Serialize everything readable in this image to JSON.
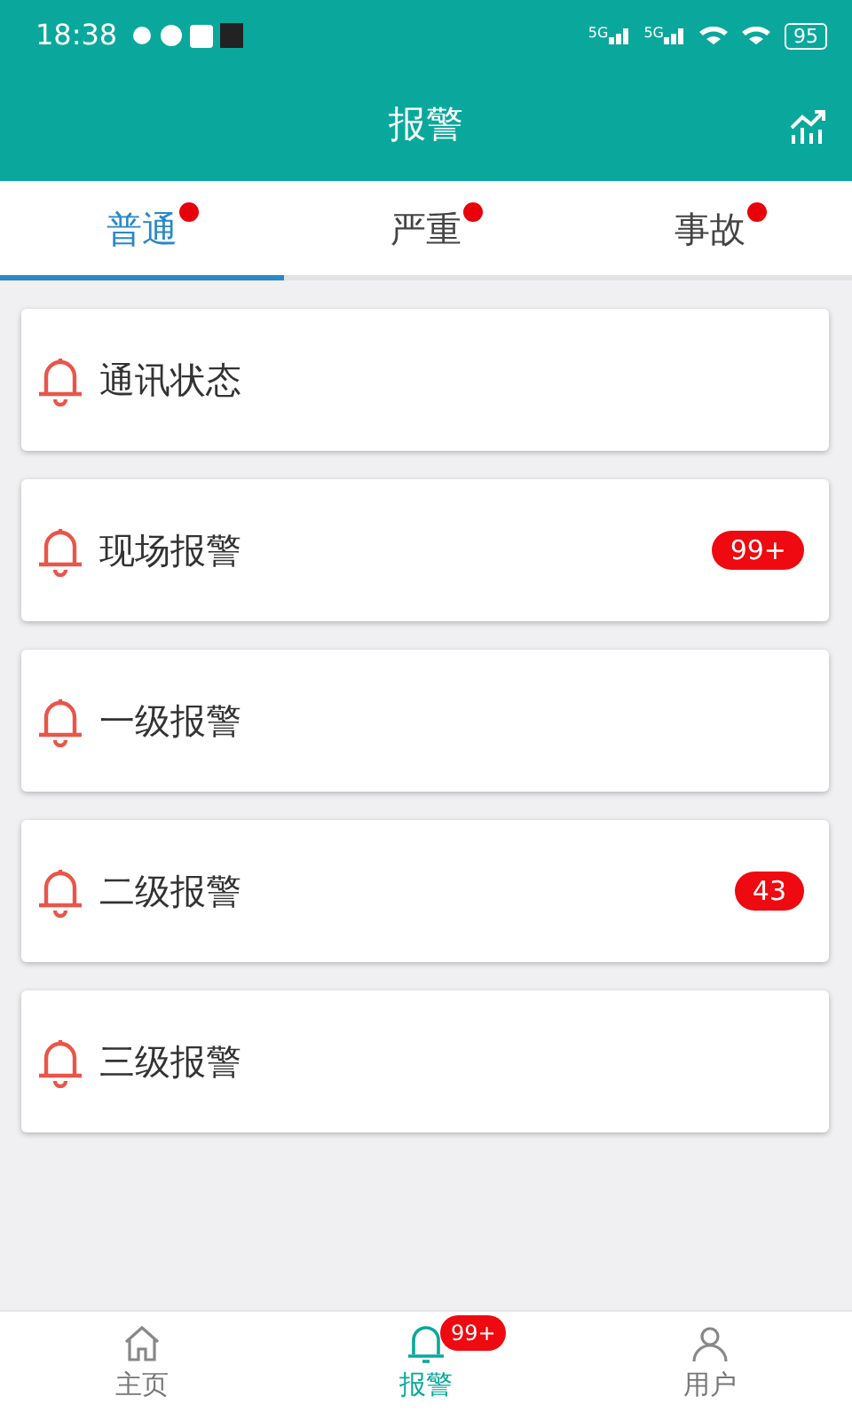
{
  "status_bar": {
    "time": "18:38",
    "networks": [
      "5G",
      "5G"
    ],
    "battery": "95"
  },
  "header": {
    "title": "报警"
  },
  "tabs": [
    {
      "label": "普通",
      "selected": true,
      "dot": true
    },
    {
      "label": "严重",
      "selected": false,
      "dot": true
    },
    {
      "label": "事故",
      "selected": false,
      "dot": true
    }
  ],
  "alarms": [
    {
      "label": "通讯状态"
    },
    {
      "label": "现场报警",
      "count": "99+"
    },
    {
      "label": "一级报警"
    },
    {
      "label": "二级报警",
      "count": "43"
    },
    {
      "label": "三级报警"
    }
  ],
  "bottom_nav": [
    {
      "label": "主页",
      "kind": "home",
      "selected": false
    },
    {
      "label": "报警",
      "kind": "alarm",
      "selected": true,
      "badge": "99+"
    },
    {
      "label": "用户",
      "kind": "user",
      "selected": false
    }
  ]
}
